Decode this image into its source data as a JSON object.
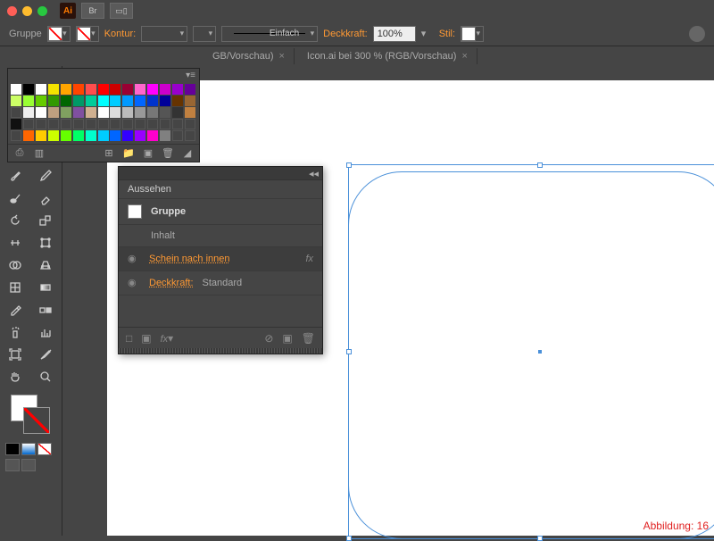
{
  "titlebar": {
    "logo": "Ai",
    "br": "Br",
    "layout_icon": "▭▯"
  },
  "controlbar": {
    "selection": "Gruppe",
    "kontur_label": "Kontur:",
    "stroke_style": "Einfach",
    "deckkraft_label": "Deckkraft:",
    "opacity": "100%",
    "stil_label": "Stil:"
  },
  "tabs": [
    {
      "label": "GB/Vorschau)"
    },
    {
      "label": "Icon.ai bei 300 % (RGB/Vorschau)"
    }
  ],
  "swatches": {
    "rows": [
      [
        "#fff",
        "#000",
        "#fff",
        "#f4e300",
        "#ffa500",
        "#ff4500",
        "#ff4d4d",
        "#ff0000",
        "#cc0000",
        "#990033",
        "#ff66cc",
        "#ff00ff",
        "#cc00cc",
        "#9900cc",
        "#660099"
      ],
      [
        "#ccff66",
        "#99ff33",
        "#66cc00",
        "#339900",
        "#006600",
        "#009966",
        "#00cc99",
        "#00ffff",
        "#00ccff",
        "#0099ff",
        "#0066ff",
        "#0033cc",
        "#000099",
        "#663300",
        "#996633"
      ],
      [
        "#454545",
        "#eeeeee",
        "#fff",
        "#c0a080",
        "#80a060",
        "#8050a0",
        "#d0b090",
        "#ffffff",
        "#dddddd",
        "#bbbbbb",
        "#999999",
        "#777777",
        "#555555",
        "#333333",
        "#c08040"
      ],
      [
        "#111",
        "#454545",
        "#454545",
        "#454545",
        "#454545",
        "#454545",
        "#454545",
        "#454545",
        "#454545",
        "#454545",
        "#454545",
        "#454545",
        "#454545",
        "#454545",
        "#454545"
      ],
      [
        "#454545",
        "#ff6600",
        "#ffcc00",
        "#ccff00",
        "#66ff00",
        "#00ff66",
        "#00ffcc",
        "#00ccff",
        "#0066ff",
        "#3300ff",
        "#9900ff",
        "#ff00cc",
        "#808080",
        "#454545",
        "#454545"
      ]
    ]
  },
  "appearance": {
    "title": "Aussehen",
    "group": "Gruppe",
    "inhalt": "Inhalt",
    "schein": "Schein nach innen",
    "deck_label": "Deckkraft:",
    "deck_val": "Standard",
    "fx": "fx"
  },
  "caption": "Abbildung: 16"
}
